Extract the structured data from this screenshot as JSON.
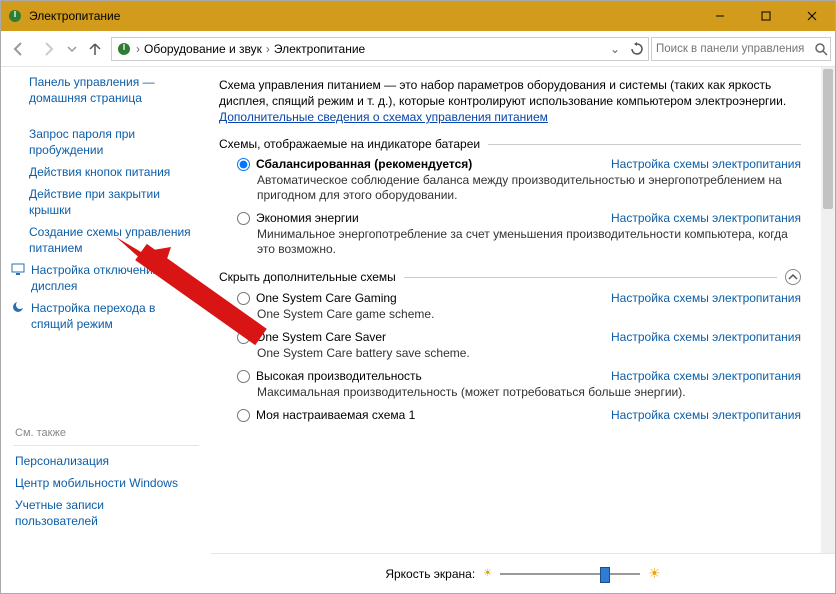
{
  "window": {
    "title": "Электропитание",
    "sys": {
      "min": "—",
      "max": "▢",
      "close": "✕"
    }
  },
  "nav": {
    "crumb1": "Оборудование и звук",
    "crumb2": "Электропитание",
    "search_placeholder": "Поиск в панели управления"
  },
  "sidebar": {
    "home_l1": "Панель управления —",
    "home_l2": "домашняя страница",
    "items": [
      "Запрос пароля при\nпробуждении",
      "Действия кнопок питания",
      "Действие при закрытии\nкрышки",
      "Создание схемы управления\nпитанием",
      "Настройка отключения\nдисплея",
      "Настройка перехода в\nспящий режим"
    ],
    "seealso": "См. также",
    "persona": "Персонализация",
    "mobility": "Центр мобильности Windows",
    "accounts_l1": "Учетные записи",
    "accounts_l2": "пользователей"
  },
  "content": {
    "intro": "Схема управления питанием — это набор параметров оборудования и системы (таких как яркость дисплея, спящий режим и т. д.), которые контролируют использование компьютером электроэнергии. ",
    "intro_link": "Дополнительные сведения о схемах управления питанием",
    "section1": "Схемы, отображаемые на индикаторе батареи",
    "section2": "Скрыть дополнительные схемы",
    "change_link": "Настройка схемы электропитания",
    "plans": [
      {
        "name": "Сбалансированная (рекомендуется)",
        "desc": "Автоматическое соблюдение баланса между производительностью и энергопотреблением на пригодном для этого оборудовании.",
        "selected": true,
        "bold": true
      },
      {
        "name": "Экономия энергии",
        "desc": "Минимальное энергопотребление за счет уменьшения производительности компьютера, когда это возможно.",
        "selected": false,
        "bold": false
      }
    ],
    "hidden_plans": [
      {
        "name": "One System Care Gaming",
        "desc": "One System Care game scheme."
      },
      {
        "name": "One System Care Saver",
        "desc": "One System Care battery save scheme."
      },
      {
        "name": "Высокая производительность",
        "desc": "Максимальная производительность (может потребоваться больше энергии)."
      },
      {
        "name": "Моя настраиваемая схема 1",
        "desc": ""
      }
    ],
    "brightness_label": "Яркость экрана:"
  }
}
